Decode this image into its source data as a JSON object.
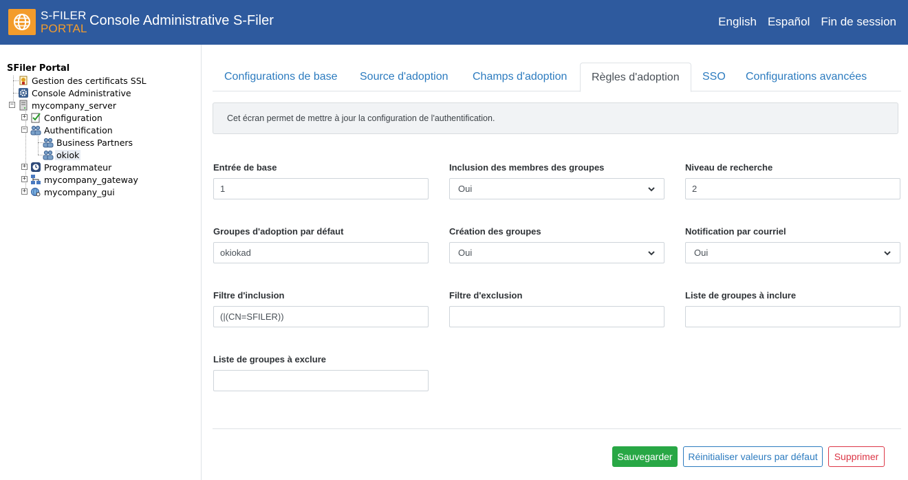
{
  "header": {
    "logo_line1": "S-FILER",
    "logo_line2": "PORTAL",
    "title": "Console Administrative S-Filer",
    "nav": [
      "English",
      "Español",
      "Fin de session"
    ],
    "bg_color": "#2e5a9e",
    "accent_color": "#f39c2c"
  },
  "sidebar": {
    "root": "SFiler Portal",
    "items": [
      {
        "label": "Gestion des certificats SSL",
        "icon": "certificate-icon"
      },
      {
        "label": "Console Administrative",
        "icon": "gear-icon"
      },
      {
        "label": "mycompany_server",
        "icon": "server-icon",
        "expanded": true
      },
      {
        "label": "Configuration",
        "icon": "checklist-icon",
        "expanded": false
      },
      {
        "label": "Authentification",
        "icon": "users-icon",
        "expanded": true
      },
      {
        "label": "Business Partners",
        "icon": "users-icon"
      },
      {
        "label": "okiok",
        "icon": "users-icon",
        "selected": true
      },
      {
        "label": "Programmateur",
        "icon": "clock-icon",
        "expanded": false
      },
      {
        "label": "mycompany_gateway",
        "icon": "network-icon",
        "expanded": false
      },
      {
        "label": "mycompany_gui",
        "icon": "globe-search-icon",
        "expanded": false
      }
    ]
  },
  "tabs": [
    {
      "label": "Configurations de base",
      "active": false
    },
    {
      "label": "Source d'adoption",
      "active": false
    },
    {
      "label": "Champs d'adoption",
      "active": false
    },
    {
      "label": "Règles d'adoption",
      "active": true
    },
    {
      "label": "SSO",
      "active": false
    },
    {
      "label": "Configurations avancées",
      "active": false
    }
  ],
  "info_text": "Cet écran permet de mettre à jour la configuration de l'authentification.",
  "form": {
    "entree_base": {
      "label": "Entrée de base",
      "value": "1"
    },
    "inclusion_membres": {
      "label": "Inclusion des membres des groupes",
      "value": "Oui"
    },
    "niveau_recherche": {
      "label": "Niveau de recherche",
      "value": "2"
    },
    "groupes_adoption": {
      "label": "Groupes d'adoption par défaut",
      "value": "okiokad"
    },
    "creation_groupes": {
      "label": "Création des groupes",
      "value": "Oui"
    },
    "notification_courriel": {
      "label": "Notification par courriel",
      "value": "Oui"
    },
    "filtre_inclusion": {
      "label": "Filtre d'inclusion",
      "value": "(|(CN=SFILER))"
    },
    "filtre_exclusion": {
      "label": "Filtre d'exclusion",
      "value": ""
    },
    "groupes_inclure": {
      "label": "Liste de groupes à inclure",
      "value": ""
    },
    "groupes_exclure": {
      "label": "Liste de groupes à exclure",
      "value": ""
    }
  },
  "buttons": {
    "save": "Sauvegarder",
    "reset": "Réinitialiser valeurs par défaut",
    "delete": "Supprimer"
  },
  "colors": {
    "link": "#2c7bbf",
    "success": "#28a745",
    "danger": "#dc3545"
  }
}
